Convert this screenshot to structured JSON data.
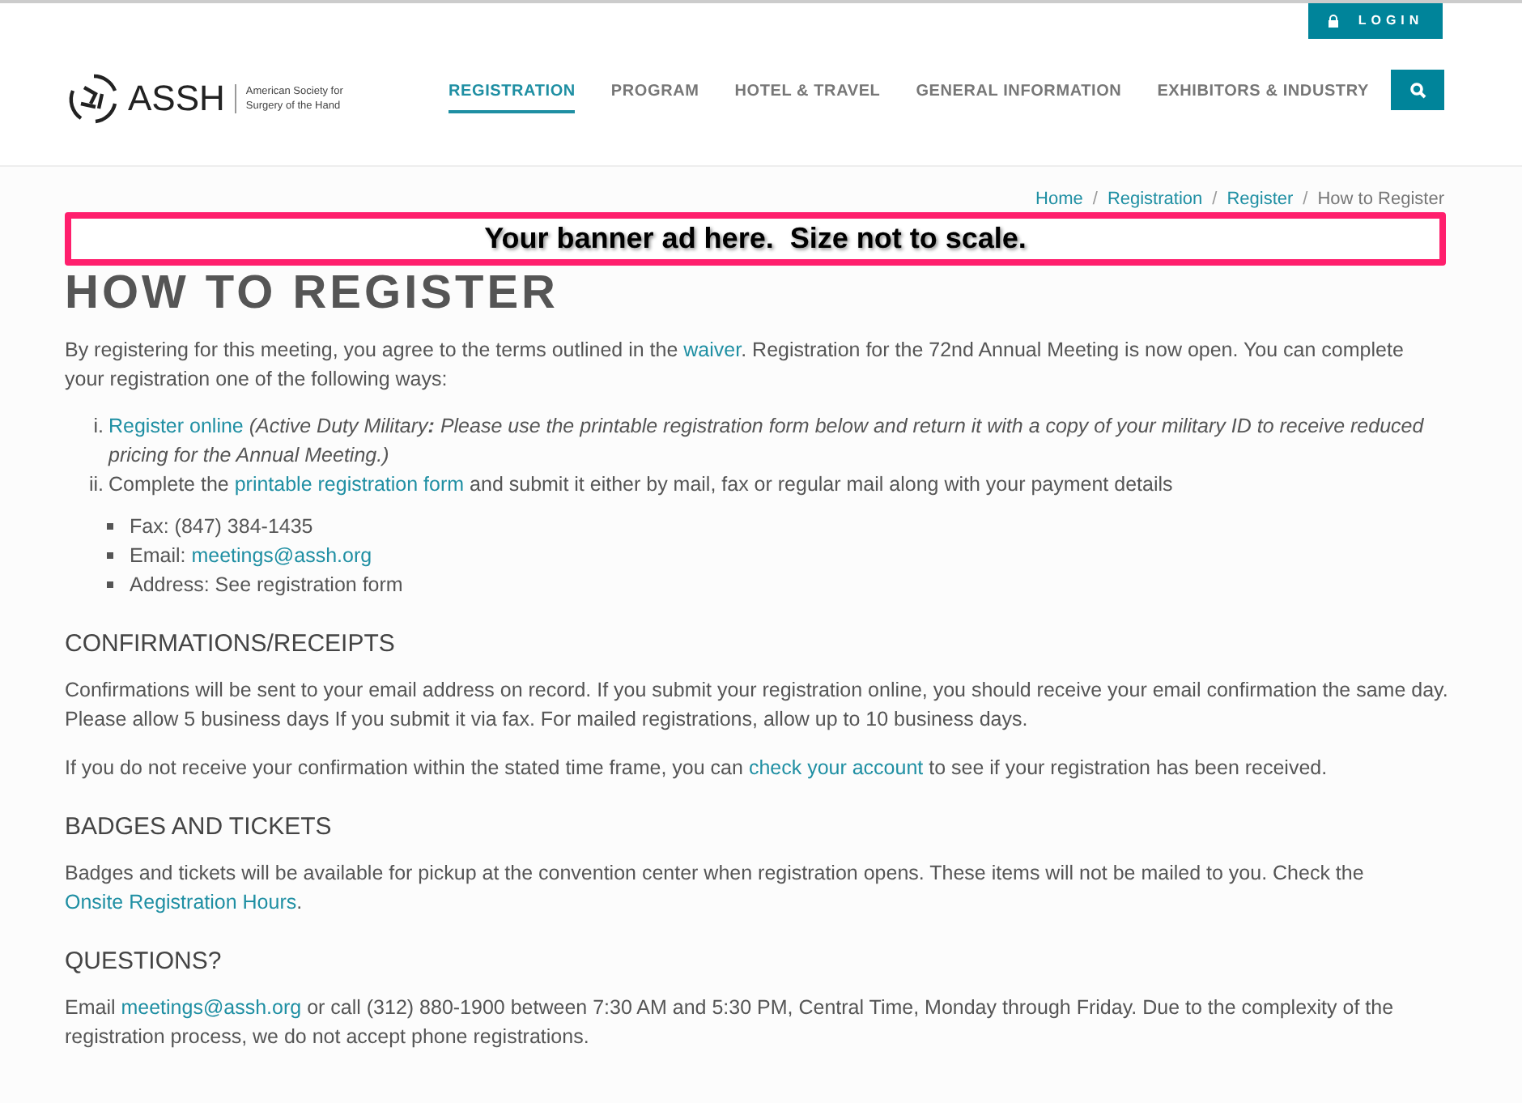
{
  "header": {
    "logo_text": "ASSH",
    "logo_subtitle": [
      "American Society for",
      "Surgery of the Hand"
    ],
    "login": "LOGIN",
    "nav": [
      {
        "label": "REGISTRATION",
        "selected": true
      },
      {
        "label": "PROGRAM",
        "selected": false
      },
      {
        "label": "HOTEL & TRAVEL",
        "selected": false
      },
      {
        "label": "GENERAL INFORMATION",
        "selected": false
      },
      {
        "label": "EXHIBITORS & INDUSTRY",
        "selected": false
      }
    ]
  },
  "breadcrumb_separator": "/",
  "breadcrumb": [
    {
      "label": "Home",
      "kind": "link"
    },
    {
      "label": "Registration",
      "kind": "link"
    },
    {
      "label": "Register",
      "kind": "link"
    },
    {
      "label": "How to Register",
      "kind": "current"
    }
  ],
  "banner": "Your banner ad here.  Size not to scale.",
  "title": "HOW TO REGISTER",
  "intro": [
    {
      "kind": "text",
      "text": "By registering for this meeting, you agree to the terms outlined in the "
    },
    {
      "kind": "link",
      "text": "waiver"
    },
    {
      "kind": "text",
      "text": ". Registration for the 72nd Annual Meeting is now open. You can complete your registration one of the following ways:"
    }
  ],
  "ways": [
    {
      "marker": "i.",
      "segments": [
        {
          "kind": "link",
          "text": "Register online"
        },
        {
          "kind": "italic",
          "text": " (Active Duty Military"
        },
        {
          "kind": "bolditalic",
          "text": ":"
        },
        {
          "kind": "italic",
          "text": "  Please use the printable registration form below and return it with a copy of your military ID to receive reduced pricing for the Annual Meeting.)"
        }
      ]
    },
    {
      "marker": "ii.",
      "segments": [
        {
          "kind": "text",
          "text": "Complete the "
        },
        {
          "kind": "link",
          "text": "printable registration form"
        },
        {
          "kind": "text",
          "text": " and submit it either by mail, fax or regular mail along with your payment details"
        }
      ]
    }
  ],
  "contacts": [
    [
      {
        "kind": "text",
        "text": "Fax: (847) 384-1435"
      }
    ],
    [
      {
        "kind": "text",
        "text": "Email: "
      },
      {
        "kind": "link",
        "text": "meetings@assh.org"
      }
    ],
    [
      {
        "kind": "text",
        "text": "Address: See registration form"
      }
    ]
  ],
  "sections": [
    {
      "heading": "CONFIRMATIONS/RECEIPTS",
      "paragraphs": [
        [
          {
            "kind": "text",
            "text": "Confirmations will be sent to your email address on record.  If you submit your registration online, you should receive your email confirmation the same day.  Please allow 5 business days If you submit it via fax.  For mailed registrations, allow up to 10 business days."
          }
        ],
        [
          {
            "kind": "text",
            "text": "If you do not receive your confirmation within the stated time frame, you can "
          },
          {
            "kind": "link",
            "text": "check your account"
          },
          {
            "kind": "text",
            "text": " to see if your registration has been received."
          }
        ]
      ]
    },
    {
      "heading": "BADGES AND TICKETS",
      "paragraphs": [
        [
          {
            "kind": "text",
            "text": "Badges and tickets will be available for pickup at the convention center when registration opens.  These items will not be mailed to you. Check the "
          },
          {
            "kind": "link",
            "text": "Onsite Registration Hours"
          },
          {
            "kind": "text",
            "text": "."
          }
        ]
      ]
    },
    {
      "heading": "QUESTIONS?",
      "paragraphs": [
        [
          {
            "kind": "text",
            "text": "Email "
          },
          {
            "kind": "link",
            "text": "meetings@assh.org"
          },
          {
            "kind": "text",
            "text": " or call (312) 880-1900 between 7:30 AM and 5:30 PM, Central Time, Monday through Friday.  Due to the complexity of the registration process, we do not accept phone registrations."
          }
        ]
      ]
    }
  ]
}
